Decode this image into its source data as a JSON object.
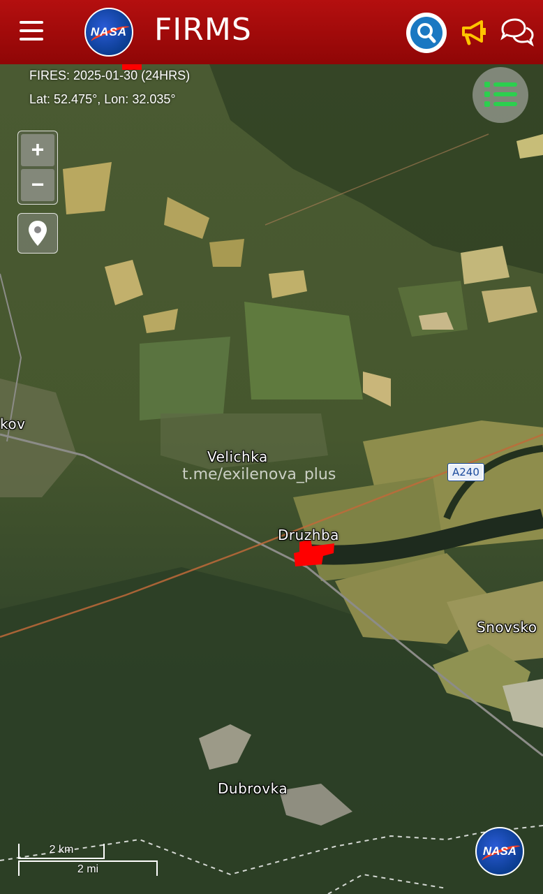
{
  "header": {
    "title": "FIRMS",
    "logo_text": "NASA",
    "menu_icon": "hamburger-menu-icon",
    "search_icon": "search-icon",
    "announce_icon": "megaphone-icon",
    "chat_icon": "chat-icon",
    "bg_color": "#a50b0b"
  },
  "map": {
    "fires_text": "FIRES: 2025-01-30 (24HRS)",
    "coords_text": "Lat: 52.475°, Lon: 32.035°",
    "zoom_in": "+",
    "zoom_out": "−",
    "locate_icon": "map-pin-icon",
    "layers_icon": "layers-list-icon",
    "fire_color": "#ff0000",
    "labels": {
      "kokov": "kov",
      "velichka": "Velichka",
      "druzhba": "Druzhba",
      "snovsko": "Snovsko",
      "dubrovka": "Dubrovka"
    },
    "road_shield": "A240",
    "watermark": "t.me/exilenova_plus",
    "scale": {
      "km": "2 km",
      "mi": "2 mi"
    },
    "badge_text": "NASA"
  }
}
